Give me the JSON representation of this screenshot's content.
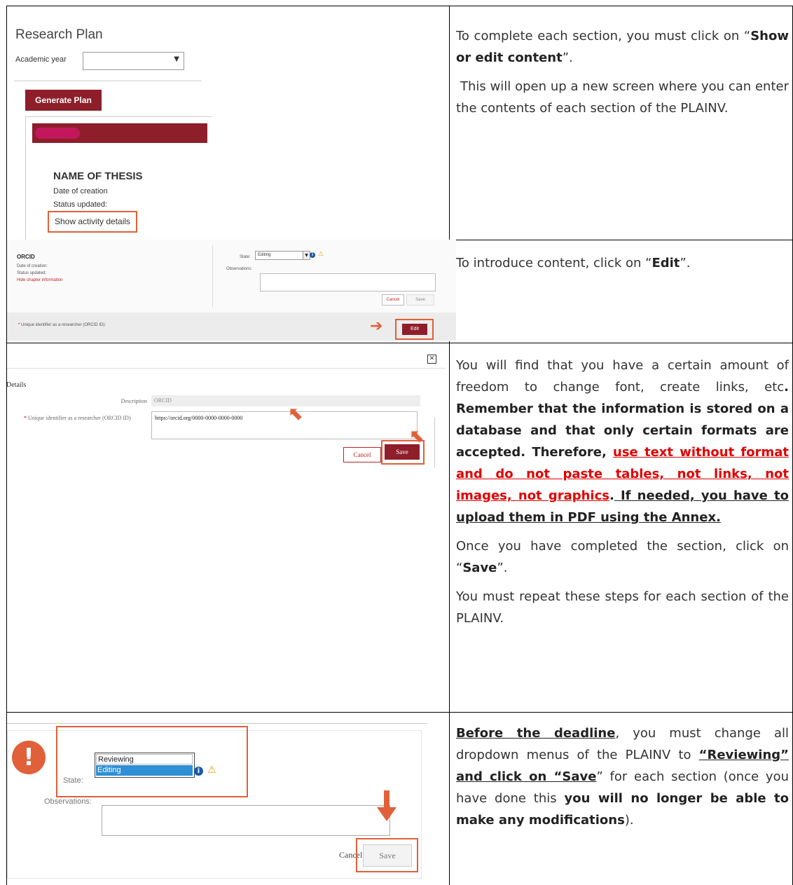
{
  "row1": {
    "title": "Research Plan",
    "academic_year_label": "Academic year",
    "academic_year_value": "",
    "generate_button": "Generate Plan",
    "thesis_name": "NAME OF THESIS",
    "date_of_creation": "Date of creation",
    "status_updated": "Status updated:",
    "show_details": "Show activity details",
    "instruction_a_pre": "To complete each section, you must click on “",
    "instruction_a_bold": "Show or edit content",
    "instruction_a_post": "”.",
    "instruction_b": "This will open up a new screen where you can enter the contents of each section of the PLAINV."
  },
  "row2": {
    "section_title": "ORCID",
    "date_of_creation": "Date of creation:",
    "status_updated": "Status updated:",
    "hide_chapter": "Hide chapter information",
    "state_label": "State:",
    "state_value": "Editing",
    "observations_label": "Observations:",
    "cancel_button": "Cancel",
    "save_button": "Save",
    "uid_label": "Unique identifier as a researcher (ORCID ID):",
    "edit_button": "Edit",
    "instruction_pre": "To introduce content, click on “",
    "instruction_bold": "Edit",
    "instruction_post": "”."
  },
  "row3": {
    "details_title": "Details",
    "description_label": "Description",
    "description_value": "ORCID",
    "uid_label": "Unique identifier as a researcher (ORCID ID)",
    "uid_value": "https://orcid.org/0000-0000-0000-0000",
    "cancel_button": "Cancel",
    "save_button": "Save",
    "p1_normal": "You will find that you have a certain amount of freedom to change font, create links, etc",
    "p1_bold": ". Remember that the information is stored on a database and that only certain formats are accepted. Therefore, ",
    "p1_red": "use text without format and do not paste tables, not links, not images, not graphics",
    "p1_dot": ".",
    "p1_underlined": " If needed, you have to upload them in PDF using the Annex.",
    "p2_pre": "Once you have completed the section, click on “",
    "p2_bold": "Save",
    "p2_post": "”.",
    "p3": "You must repeat these steps for each section of the PLAINV."
  },
  "row4": {
    "option_reviewing": "Reviewing",
    "option_editing": "Editing",
    "state_label": "State:",
    "observations_label": "Observations:",
    "cancel_button": "Cancel",
    "save_button": "Save",
    "p_bold_u": "Before the deadline",
    "p_mid": ", you must change all dropdown menus of the PLAINV to ",
    "p_bold_u2": "“Reviewing” and click on “Save",
    "p_mid2": "” for each section (once you have done this ",
    "p_bold": "you will no longer be able to make any modifications",
    "p_end": ")."
  },
  "colors": {
    "brand": "#8e1e2a",
    "highlight": "#e0603a",
    "emphasis_red": "#e10000"
  }
}
